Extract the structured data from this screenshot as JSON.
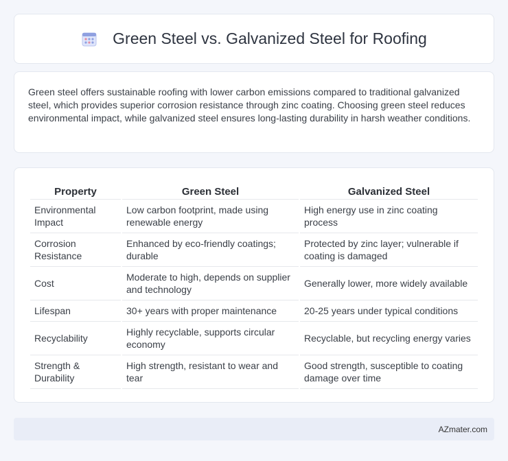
{
  "header": {
    "title": "Green Steel vs. Galvanized Steel for Roofing",
    "icon": "calendar-icon"
  },
  "intro": {
    "text": "Green steel offers sustainable roofing with lower carbon emissions compared to traditional galvanized steel, which provides superior corrosion resistance through zinc coating. Choosing green steel reduces environmental impact, while galvanized steel ensures long-lasting durability in harsh weather conditions."
  },
  "table": {
    "headers": [
      "Property",
      "Green Steel",
      "Galvanized Steel"
    ],
    "rows": [
      [
        "Environmental Impact",
        "Low carbon footprint, made using renewable energy",
        "High energy use in zinc coating process"
      ],
      [
        "Corrosion Resistance",
        "Enhanced by eco-friendly coatings; durable",
        "Protected by zinc layer; vulnerable if coating is damaged"
      ],
      [
        "Cost",
        "Moderate to high, depends on supplier and technology",
        "Generally lower, more widely available"
      ],
      [
        "Lifespan",
        "30+ years with proper maintenance",
        "20-25 years under typical conditions"
      ],
      [
        "Recyclability",
        "Highly recyclable, supports circular economy",
        "Recyclable, but recycling energy varies"
      ],
      [
        "Strength & Durability",
        "High strength, resistant to wear and tear",
        "Good strength, susceptible to coating damage over time"
      ]
    ]
  },
  "footer": {
    "brand": "AZmater.com"
  },
  "colors": {
    "background": "#f4f6fb",
    "card": "#ffffff",
    "footer": "#e9edf7",
    "icon_accent": "#7b8fd6"
  }
}
